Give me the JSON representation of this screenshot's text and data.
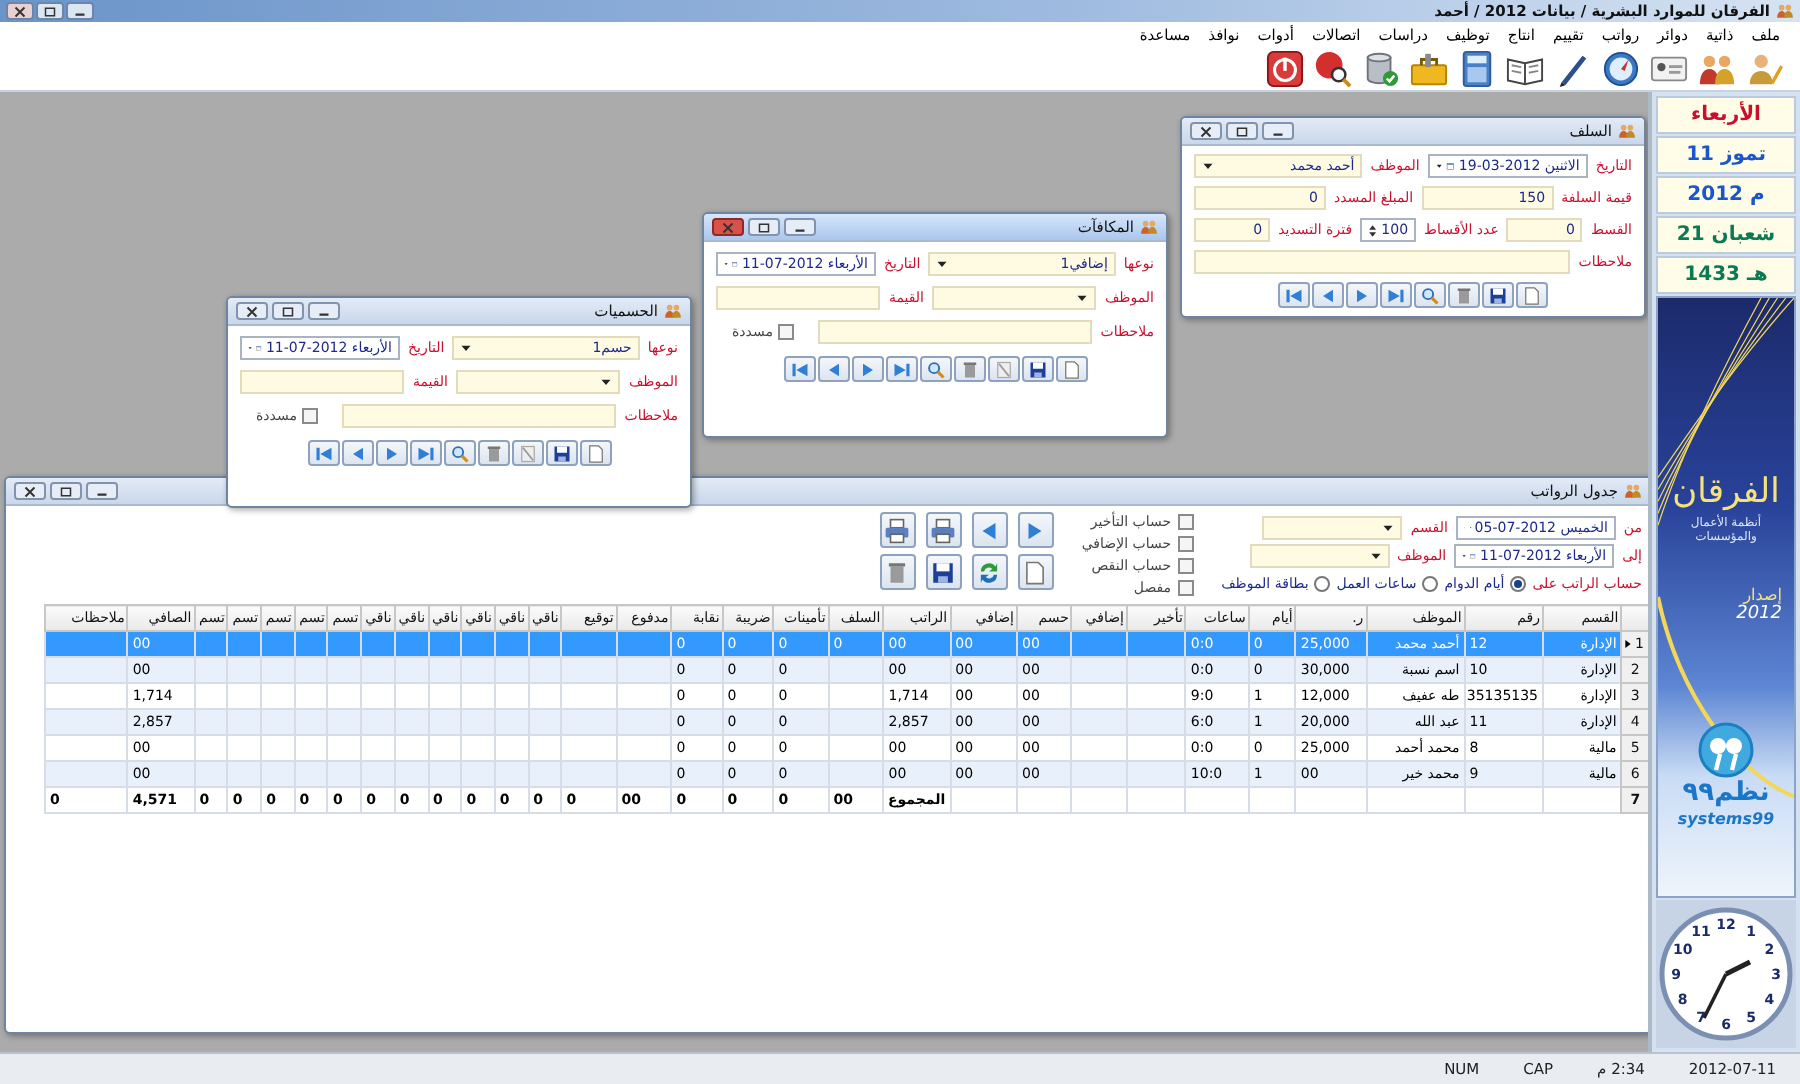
{
  "titlebar": {
    "title": "الفرقان للموارد البشرية / بيانات 2012 / أحمد"
  },
  "menu": [
    "ملف",
    "ذاتية",
    "دوائر",
    "رواتب",
    "تقييم",
    "انتاج",
    "توظيف",
    "دراسات",
    "اتصالات",
    "أدوات",
    "نوافذ",
    "مساعدة"
  ],
  "sidebar": {
    "dates": [
      {
        "text": "الأربعاء",
        "kind": "weekday"
      },
      {
        "text": "تموز 11",
        "kind": "gregorian"
      },
      {
        "text": "م 2012",
        "kind": "gregorian"
      },
      {
        "text": "شعبان 21",
        "kind": "hijri"
      },
      {
        "text": "هـ 1433",
        "kind": "hijri"
      }
    ],
    "banner": {
      "brand": "الفرقان",
      "tagline": "أنظمة الأعمال والمؤسسات",
      "edition_label": "إصدار",
      "edition_year": "2012",
      "maker": "نظم٩٩",
      "maker_latin": "systems99"
    },
    "clock": {
      "numerals": [
        "12",
        "11",
        "1",
        "10",
        "2",
        "9",
        "3",
        "8",
        "4",
        "7",
        "5",
        "6"
      ]
    }
  },
  "forms": [
    {
      "title": "السلف",
      "active": false,
      "rows": [
        [
          {
            "label": "التاريخ",
            "kind": "date",
            "value": "الاثنين 2012-03-19"
          },
          {
            "label": "الموظف",
            "kind": "select",
            "value": "أحمد محمد"
          }
        ],
        [
          {
            "label": "قيمة السلفة",
            "kind": "text",
            "value": "150"
          },
          {
            "label": "المبلغ المسدد",
            "kind": "text",
            "value": "0"
          }
        ],
        [
          {
            "label": "القسط",
            "kind": "text",
            "value": "0"
          },
          {
            "label": "عدد الأقساط",
            "kind": "spin",
            "value": "100"
          },
          {
            "label": "فترة التسديد",
            "kind": "text",
            "value": "0"
          }
        ],
        [
          {
            "label": "ملاحظات",
            "kind": "note"
          }
        ]
      ],
      "nav": [
        {
          "kind": "first"
        },
        {
          "kind": "prev"
        },
        {
          "kind": "next"
        },
        {
          "kind": "last"
        },
        {
          "kind": "search"
        },
        {
          "kind": "delete"
        },
        {
          "kind": "save"
        },
        {
          "kind": "new"
        }
      ]
    },
    {
      "title": "المكافآت",
      "active": true,
      "rows": [
        [
          {
            "label": "نوعها",
            "kind": "select",
            "value": "إضافي1"
          },
          {
            "label": "التاريخ",
            "kind": "date",
            "value": "الأربعاء 2012-07-11"
          }
        ],
        [
          {
            "label": "الموظف",
            "kind": "select"
          },
          {
            "label": "القيمة",
            "kind": "text"
          }
        ],
        [
          {
            "label": "ملاحظات",
            "kind": "note"
          },
          {
            "label": "مسددة",
            "kind": "check",
            "checked": false
          }
        ]
      ],
      "nav": [
        {
          "kind": "first"
        },
        {
          "kind": "prev"
        },
        {
          "kind": "next"
        },
        {
          "kind": "last"
        },
        {
          "kind": "search"
        },
        {
          "kind": "delete"
        },
        {
          "kind": "edit"
        },
        {
          "kind": "save"
        },
        {
          "kind": "new"
        }
      ]
    },
    {
      "title": "الحسميات",
      "active": false,
      "rows": [
        [
          {
            "label": "نوعها",
            "kind": "select",
            "value": "حسم1"
          },
          {
            "label": "التاريخ",
            "kind": "date",
            "value": "الأربعاء 2012-07-11"
          }
        ],
        [
          {
            "label": "الموظف",
            "kind": "select"
          },
          {
            "label": "القيمة",
            "kind": "text"
          }
        ],
        [
          {
            "label": "ملاحظات",
            "kind": "note"
          },
          {
            "label": "مسددة",
            "kind": "check",
            "checked": false
          }
        ]
      ],
      "nav": [
        {
          "kind": "first"
        },
        {
          "kind": "prev"
        },
        {
          "kind": "next"
        },
        {
          "kind": "last"
        },
        {
          "kind": "search"
        },
        {
          "kind": "delete"
        },
        {
          "kind": "edit"
        },
        {
          "kind": "save"
        },
        {
          "kind": "new"
        }
      ]
    }
  ],
  "payroll": {
    "title": "جدول الرواتب",
    "active": false,
    "filters": [
      [
        {
          "label": "من",
          "kind": "date",
          "value": "الخميس 2012-07-05"
        },
        {
          "label": "القسم",
          "kind": "select"
        }
      ],
      [
        {
          "label": "إلى",
          "kind": "date",
          "value": "الأربعاء 2012-07-11"
        },
        {
          "label": "الموظف",
          "kind": "select"
        }
      ]
    ],
    "basis": {
      "label": "حساب الراتب على",
      "choices": [
        {
          "label": "أيام الدوام",
          "selected": true
        },
        {
          "label": "ساعات العمل",
          "selected": false
        },
        {
          "label": "بطاقة الموظف",
          "selected": false
        }
      ]
    },
    "options": [
      {
        "label": "حساب التأخير",
        "checked": false
      },
      {
        "label": "حساب الإضافي",
        "checked": false
      },
      {
        "label": "حساب النقص",
        "checked": false
      },
      {
        "label": "مفصل",
        "checked": false
      }
    ],
    "buttons": [
      [
        {
          "kind": "print"
        },
        {
          "kind": "print"
        },
        {
          "kind": "prev"
        },
        {
          "kind": "next"
        }
      ],
      [
        {
          "kind": "delete"
        },
        {
          "kind": "save"
        },
        {
          "kind": "refresh"
        },
        {
          "kind": "new"
        }
      ]
    ],
    "columns": [
      "القسم",
      "رقم",
      "الموظف",
      "ر.",
      "أيام",
      "ساعات",
      "تأخير",
      "إضافي",
      "حسم",
      "إضافي",
      "الراتب",
      "السلف",
      "تأمينات",
      "ضريبة",
      "نقابة",
      "مدفوع",
      "توقيع",
      "ناقي",
      "ناقي",
      "ناقي",
      "ناقي",
      "ناقي",
      "ناقي",
      "تسم",
      "تسم",
      "تسم",
      "تسم",
      "تسم",
      "الصافي",
      "ملاحظات"
    ],
    "rows": [
      {
        "number": "1",
        "selected": true,
        "cells": [
          "الإدارة",
          "12",
          "أحمد محمد",
          "25,000",
          "0",
          "0:0",
          null,
          null,
          "00",
          "00",
          "00",
          "0",
          "0",
          "0",
          "0",
          null,
          null,
          null,
          null,
          null,
          null,
          null,
          null,
          null,
          null,
          null,
          null,
          null,
          "00",
          null
        ]
      },
      {
        "number": "2",
        "selected": false,
        "cells": [
          "الإدارة",
          "10",
          "اسم نسبة",
          "30,000",
          "0",
          "0:0",
          null,
          null,
          "00",
          "00",
          "00",
          null,
          "0",
          "0",
          "0",
          null,
          null,
          null,
          null,
          null,
          null,
          null,
          null,
          null,
          null,
          null,
          null,
          null,
          "00",
          null
        ]
      },
      {
        "number": "3",
        "selected": false,
        "cells": [
          "الإدارة",
          "35135135",
          "طه عفيف",
          "12,000",
          "1",
          "9:0",
          null,
          null,
          "00",
          "00",
          "1,714",
          null,
          "0",
          "0",
          "0",
          null,
          null,
          null,
          null,
          null,
          null,
          null,
          null,
          null,
          null,
          null,
          null,
          null,
          "1,714",
          null
        ]
      },
      {
        "number": "4",
        "selected": false,
        "cells": [
          "الإدارة",
          "11",
          "عبد الله",
          "20,000",
          "1",
          "6:0",
          null,
          null,
          "00",
          "00",
          "2,857",
          null,
          "0",
          "0",
          "0",
          null,
          null,
          null,
          null,
          null,
          null,
          null,
          null,
          null,
          null,
          null,
          null,
          null,
          "2,857",
          null
        ]
      },
      {
        "number": "5",
        "selected": false,
        "cells": [
          "مالية",
          "8",
          "محمد أحمد",
          "25,000",
          "0",
          "0:0",
          null,
          null,
          "00",
          "00",
          "00",
          null,
          "0",
          "0",
          "0",
          null,
          null,
          null,
          null,
          null,
          null,
          null,
          null,
          null,
          null,
          null,
          null,
          null,
          "00",
          null
        ]
      },
      {
        "number": "6",
        "selected": false,
        "cells": [
          "مالية",
          "9",
          "محمد خير",
          "00",
          "1",
          "10:0",
          null,
          null,
          "00",
          "00",
          "00",
          null,
          "0",
          "0",
          "0",
          null,
          null,
          null,
          null,
          null,
          null,
          null,
          null,
          null,
          null,
          null,
          null,
          null,
          "00",
          null
        ]
      }
    ],
    "totals": {
      "number": "7",
      "cells": [
        null,
        null,
        null,
        null,
        null,
        null,
        null,
        null,
        null,
        null,
        "المجموع",
        "00",
        "0",
        "0",
        "0",
        "00",
        "0",
        "0",
        "0",
        "0",
        "0",
        "0",
        "0",
        "0",
        "0",
        "0",
        "0",
        "0",
        "4,571",
        "0"
      ]
    }
  },
  "status_bar": [
    "2012-07-11",
    "2:34 م",
    "CAP",
    "NUM"
  ]
}
